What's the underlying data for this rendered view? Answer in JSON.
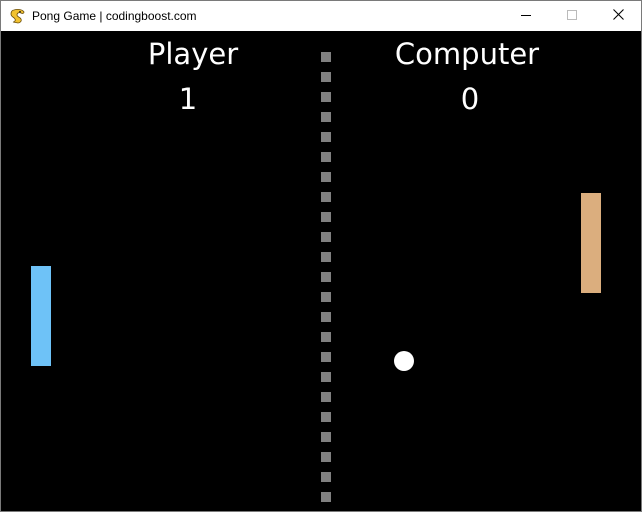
{
  "window": {
    "title": "Pong Game | codingboost.com",
    "app_icon": "pygame-snake-icon",
    "controls": {
      "minimize_icon": "minimize-icon",
      "maximize_icon": "maximize-icon",
      "close_icon": "close-icon"
    }
  },
  "game": {
    "background": "#000000",
    "player": {
      "label": "Player",
      "score": "1",
      "paddle_color": "#6ec2f7"
    },
    "computer": {
      "label": "Computer",
      "score": "0",
      "paddle_color": "#dbae7e"
    },
    "ball_color": "#ffffff",
    "divider_color": "#808080"
  }
}
